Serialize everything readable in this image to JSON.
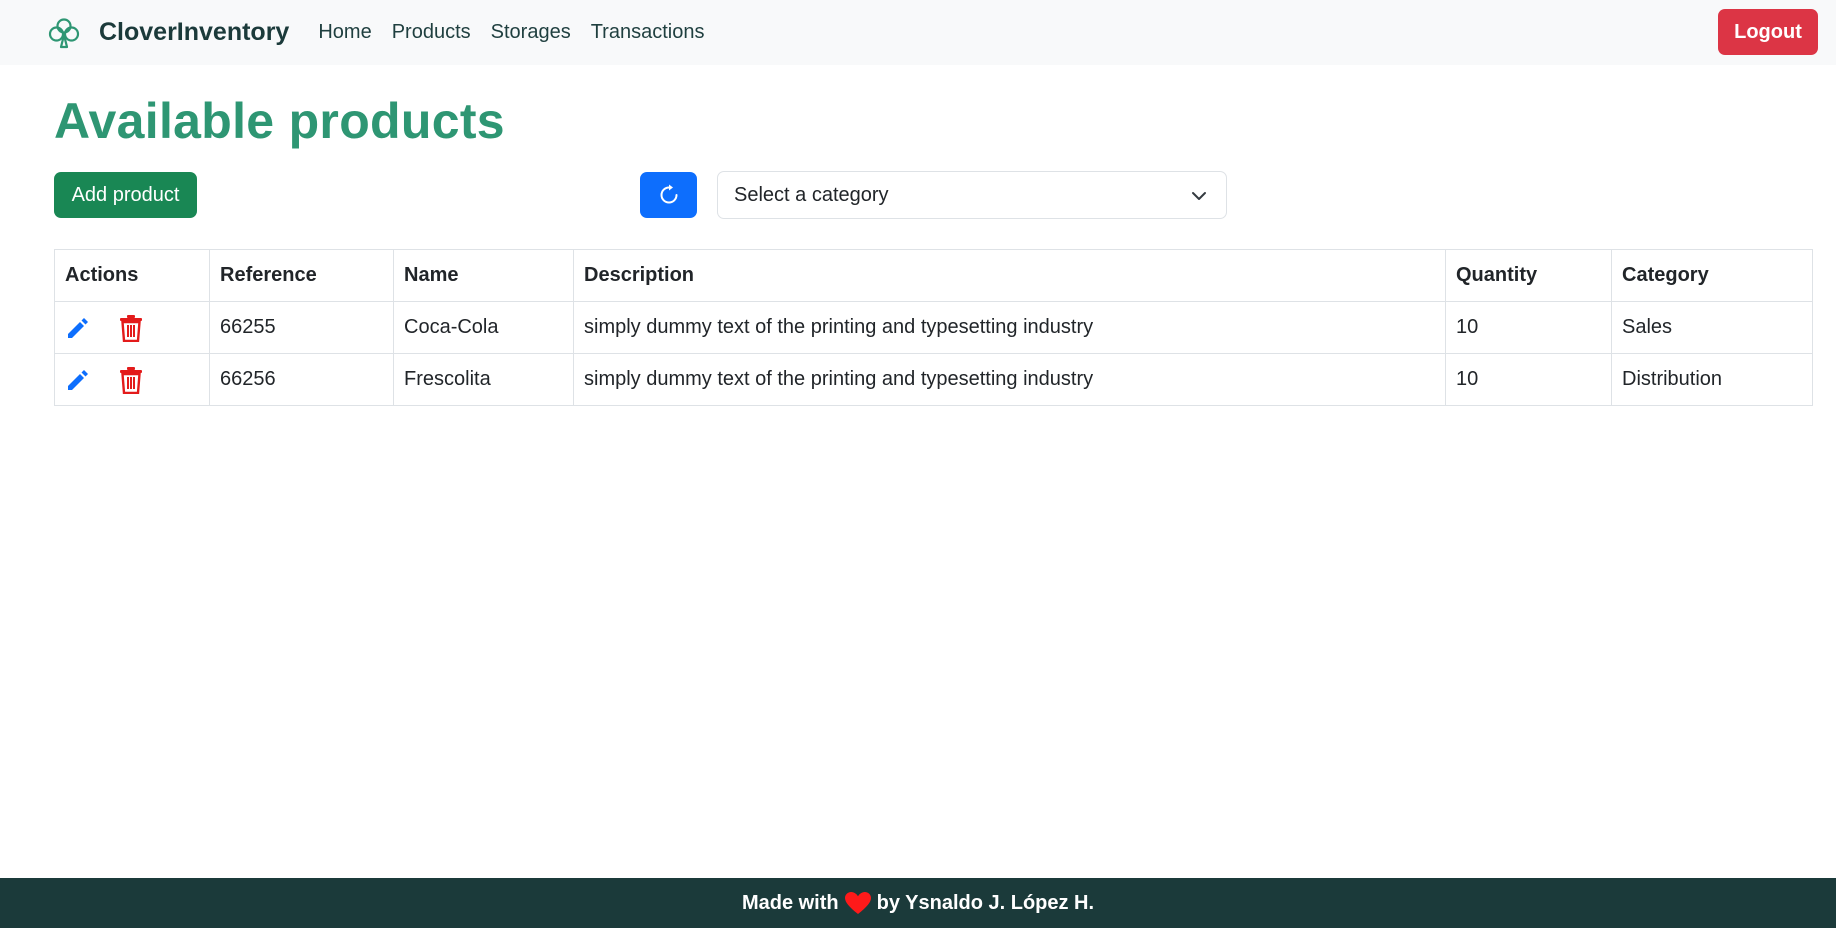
{
  "navbar": {
    "brand": "CloverInventory",
    "brand_icon": "clover-icon",
    "links": [
      "Home",
      "Products",
      "Storages",
      "Transactions"
    ],
    "logout_label": "Logout"
  },
  "page": {
    "title": "Available products",
    "add_label": "Add product",
    "refresh_icon": "refresh-icon",
    "category_select": {
      "selected": "Select a category",
      "icon": "chevron-down-icon"
    }
  },
  "table": {
    "headers": [
      "Actions",
      "Reference",
      "Name",
      "Description",
      "Quantity",
      "Category"
    ],
    "rows": [
      {
        "reference": "66255",
        "name": "Coca-Cola",
        "description": "simply dummy text of the printing and typesetting industry",
        "quantity": "10",
        "category": "Sales"
      },
      {
        "reference": "66256",
        "name": "Frescolita",
        "description": "simply dummy text of the printing and typesetting industry",
        "quantity": "10",
        "category": "Distribution"
      }
    ]
  },
  "footer": {
    "prefix": "Made with",
    "suffix": "by Ysnaldo J. López H.",
    "icon": "heart-icon"
  },
  "colors": {
    "accent_green": "#2e9673",
    "success": "#198754",
    "primary": "#0d6efd",
    "danger": "#dc3545",
    "footer_bg": "#1b3a3a"
  }
}
